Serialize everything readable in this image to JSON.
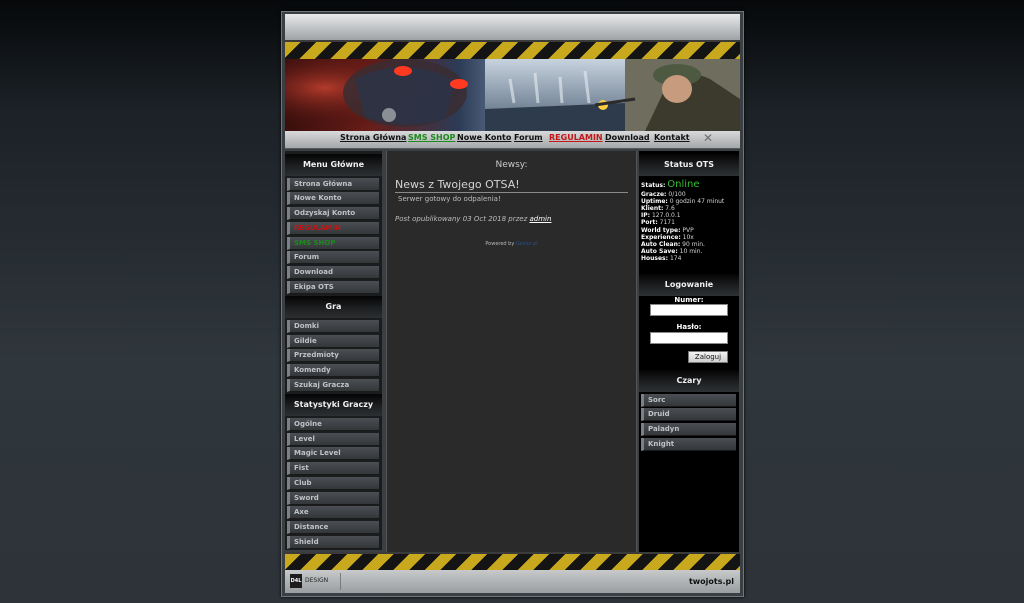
{
  "nav": {
    "items": [
      {
        "label": "Strona Główna",
        "color": "#111111"
      },
      {
        "label": "SMS SHOP",
        "color": "#1c8a1c"
      },
      {
        "label": "Nowe Konto",
        "color": "#111111"
      },
      {
        "label": "Forum",
        "color": "#111111"
      },
      {
        "label": "REGULAMIN",
        "color": "#c41616"
      },
      {
        "label": "Download",
        "color": "#111111"
      },
      {
        "label": "Kontakt",
        "color": "#111111"
      }
    ]
  },
  "menu_glowne": {
    "title": "Menu Główne",
    "items": [
      {
        "label": "Strona Główna"
      },
      {
        "label": "Nowe Konto"
      },
      {
        "label": "Odzyskaj Konto"
      },
      {
        "label": "REGULAMIN",
        "color": "#c41616"
      },
      {
        "label": "SMS SHOP",
        "color": "#1c8a1c"
      },
      {
        "label": "Forum"
      },
      {
        "label": "Download"
      },
      {
        "label": "Ekipa OTS"
      }
    ]
  },
  "gra": {
    "title": "Gra",
    "items": [
      {
        "label": "Domki"
      },
      {
        "label": "Gildie"
      },
      {
        "label": "Przedmioty"
      },
      {
        "label": "Komendy"
      },
      {
        "label": "Szukaj Gracza"
      }
    ]
  },
  "statystyki": {
    "title": "Statystyki Graczy",
    "items": [
      {
        "label": "Ogólne"
      },
      {
        "label": "Level"
      },
      {
        "label": "Magic Level"
      },
      {
        "label": "Fist"
      },
      {
        "label": "Club"
      },
      {
        "label": "Sword"
      },
      {
        "label": "Axe"
      },
      {
        "label": "Distance"
      },
      {
        "label": "Shield"
      }
    ]
  },
  "content": {
    "heading": "Newsy:",
    "news_title": "News z Twojego OTSA!",
    "news_body": "Serwer gotowy do odpalenia!",
    "posted_prefix": "Post opublikowany 03 Oct 2018 przez",
    "author": "admin",
    "powered_label": "Powered by",
    "powered_link": "Gesior.pl"
  },
  "status": {
    "title": "Status OTS",
    "status_label": "Status:",
    "status_value": "Online",
    "status_color": "#2fbf2f",
    "rows": [
      {
        "label": "Gracze:",
        "value": "0/100"
      },
      {
        "label": "Uptime:",
        "value": "0 godzin 47 minut"
      },
      {
        "label": "Klient:",
        "value": "7.6"
      },
      {
        "label": "IP:",
        "value": "127.0.0.1"
      },
      {
        "label": "Port:",
        "value": "7171"
      },
      {
        "label": "World type:",
        "value": "PVP"
      },
      {
        "label": "Experience:",
        "value": "10x"
      },
      {
        "label": "Auto Clean:",
        "value": "90 min."
      },
      {
        "label": "Auto Save:",
        "value": "10 min."
      },
      {
        "label": "Houses:",
        "value": "174"
      }
    ]
  },
  "login": {
    "title": "Logowanie",
    "account_label": "Numer:",
    "account_value": "",
    "password_label": "Hasło:",
    "password_value": "",
    "button_label": "Zaloguj"
  },
  "czary": {
    "title": "Czary",
    "items": [
      {
        "label": "Sorc"
      },
      {
        "label": "Druid"
      },
      {
        "label": "Paladyn"
      },
      {
        "label": "Knight"
      }
    ]
  },
  "footer": {
    "logo_text": "DESIGN",
    "logo_badge": "D4L",
    "site": "twojots.pl"
  }
}
